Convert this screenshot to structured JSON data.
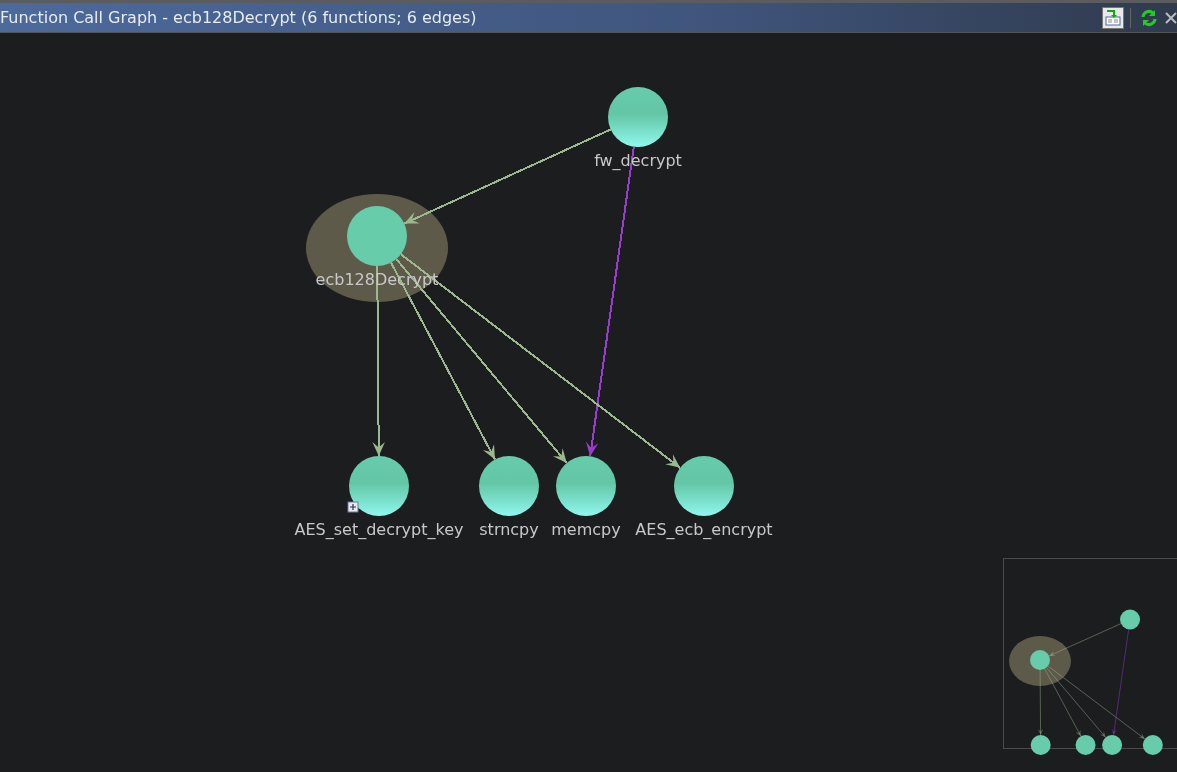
{
  "window": {
    "title": "Function Call Graph - ecb128Decrypt (6 functions; 6 edges)"
  },
  "nodes": [
    {
      "name": "fw_decrypt",
      "selected": false,
      "expandable": false
    },
    {
      "name": "ecb128Decrypt",
      "selected": true,
      "expandable": false
    },
    {
      "name": "AES_set_decrypt_key",
      "selected": false,
      "expandable": true
    },
    {
      "name": "strncpy",
      "selected": false,
      "expandable": false
    },
    {
      "name": "memcpy",
      "selected": false,
      "expandable": false
    },
    {
      "name": "AES_ecb_encrypt",
      "selected": false,
      "expandable": false
    }
  ],
  "edges": [
    {
      "color": "#9cb88e"
    },
    {
      "color": "#9a3cd0"
    },
    {
      "color": "#9cb88e"
    },
    {
      "color": "#9cb88e"
    },
    {
      "color": "#9cb88e"
    },
    {
      "color": "#9cb88e"
    }
  ]
}
